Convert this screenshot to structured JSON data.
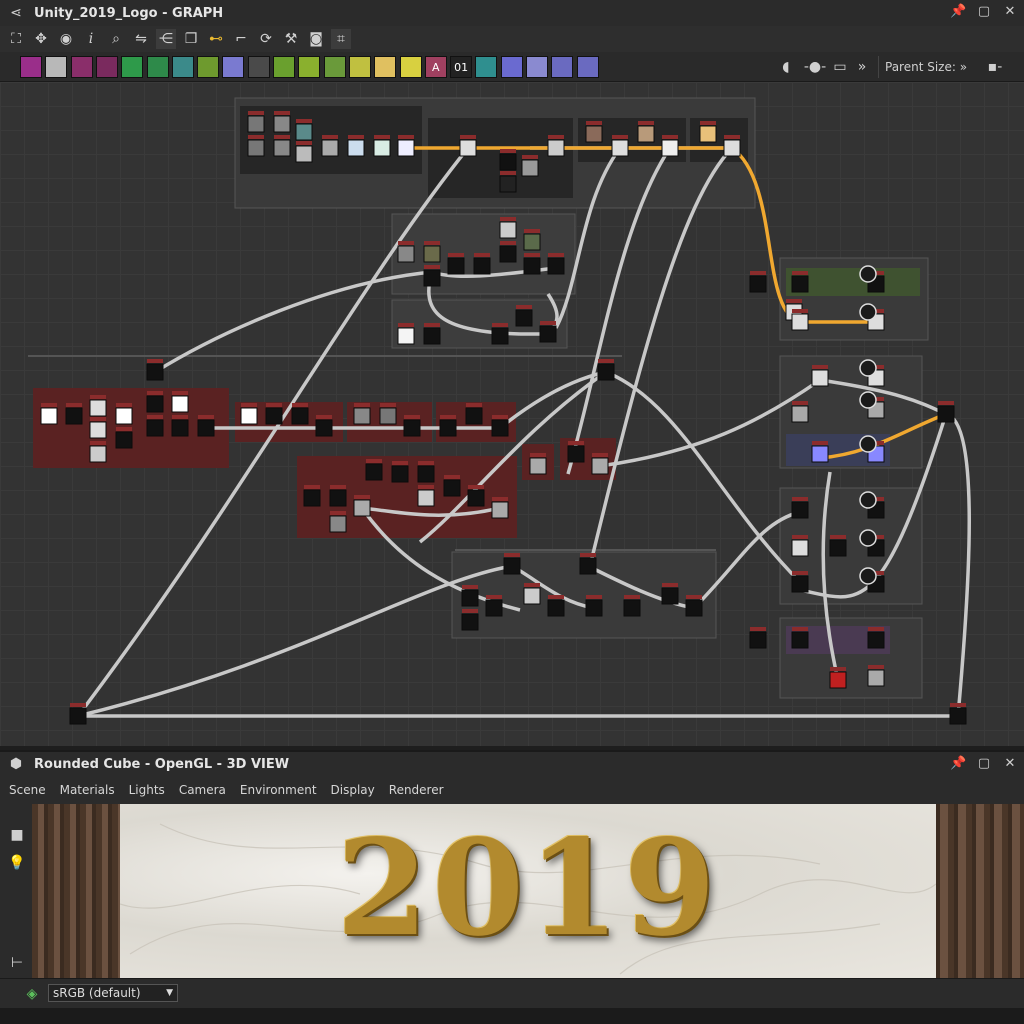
{
  "graph_panel": {
    "title": "Unity_2019_Logo - GRAPH",
    "icon": "graph-icon",
    "toolbar_icons": [
      "frame-all-icon",
      "move-icon",
      "camera-icon",
      "info-icon",
      "search-icon",
      "link-icon",
      "hierarchy-icon",
      "copy-icon",
      "connector-icon",
      "route-icon",
      "rotate-icon",
      "tools-icon",
      "screenshot-icon",
      "crop-icon"
    ],
    "parent_size_label": "Parent Size:",
    "parent_size_chevron": "»",
    "atomic_bar_overflow": "»",
    "atomic_node_colors": [
      "#9a2e8a",
      "#b8b8b8",
      "#8a2e6a",
      "#7a2a5e",
      "#2e9a4a",
      "#2e8a4a",
      "#3b8a8a",
      "#6e9a2e",
      "#7a7ad0",
      "#4a4a4a",
      "#6aa02e",
      "#8ab02e",
      "#6a9a3a",
      "#c0c040",
      "#e0c060",
      "#d8d040",
      "#a04060",
      "#222222",
      "#2f8f8f",
      "#6a6ad0",
      "#8a8ad0",
      "#6a6ac0",
      "#6a6ac0"
    ],
    "atomic_node_labels": [
      "A",
      "01",
      "01"
    ]
  },
  "view_panel": {
    "title": "Rounded Cube - OpenGL - 3D VIEW",
    "icon": "cube-icon",
    "menu": [
      "Scene",
      "Materials",
      "Lights",
      "Camera",
      "Environment",
      "Display",
      "Renderer"
    ],
    "rendered_text": "2019",
    "colorspace": "sRGB (default)"
  },
  "colors": {
    "panel_bg": "#2b2b2b",
    "canvas_bg": "#333333",
    "orange_link": "#f0a830",
    "grey_link": "#c8c8c8",
    "red_frame": "#5a2222",
    "gold_logo": "#b28a2e"
  }
}
